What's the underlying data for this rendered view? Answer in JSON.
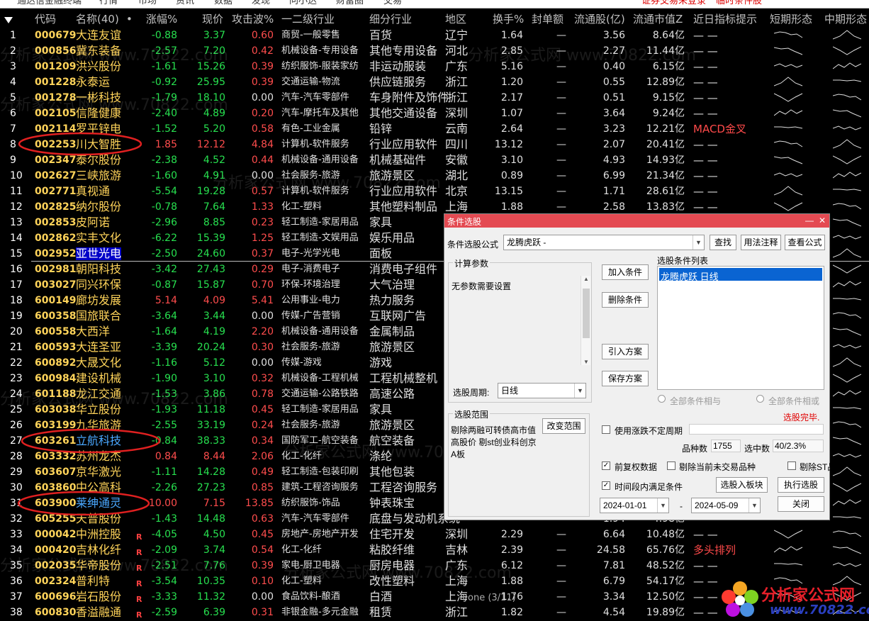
{
  "menu": {
    "items": [
      "通达信金融终端",
      "行情",
      "市场",
      "资讯",
      "数据",
      "发现",
      "问小达",
      "财富圈",
      "交易"
    ],
    "status_login": "证券交易未登录",
    "status_condition": "临时条件股"
  },
  "grid": {
    "headers": [
      "代码",
      "名称(40)",
      "•",
      "涨幅%",
      "现价",
      "攻击波%",
      "一二级行业",
      "细分行业",
      "地区",
      "换手%",
      "封单额",
      "流通股(亿)",
      "流通市值Z",
      "近日指标提示",
      "短期形态",
      "中期形态"
    ],
    "rows": [
      {
        "idx": "1",
        "code": "000679",
        "name": "大连友谊",
        "flag": "",
        "chg": "-0.88",
        "price": "3.37",
        "atk": "0.60",
        "ind1": "商贸-一般零售",
        "ind2": "百货",
        "region": "辽宁",
        "turn": "1.64",
        "seal": "—",
        "cap": "3.56",
        "mcap": "8.64亿",
        "hint": "— —"
      },
      {
        "idx": "2",
        "code": "000856",
        "name": "冀东装备",
        "flag": "",
        "chg": "-2.57",
        "price": "7.20",
        "atk": "0.42",
        "ind1": "机械设备-专用设备",
        "ind2": "其他专用设备",
        "region": "河北",
        "turn": "2.85",
        "seal": "—",
        "cap": "2.27",
        "mcap": "11.44亿",
        "hint": "— —"
      },
      {
        "idx": "3",
        "code": "001209",
        "name": "洪兴股份",
        "flag": "",
        "chg": "-1.61",
        "price": "15.26",
        "atk": "0.39",
        "ind1": "纺织服饰-服装家纺",
        "ind2": "非运动服装",
        "region": "广东",
        "turn": "5.16",
        "seal": "—",
        "cap": "0.40",
        "mcap": "6.15亿",
        "hint": "— —"
      },
      {
        "idx": "4",
        "code": "001228",
        "name": "永泰运",
        "flag": "",
        "chg": "-0.92",
        "price": "25.95",
        "atk": "0.39",
        "ind1": "交通运输-物流",
        "ind2": "供应链服务",
        "region": "浙江",
        "turn": "1.20",
        "seal": "—",
        "cap": "0.55",
        "mcap": "12.89亿",
        "hint": "— —"
      },
      {
        "idx": "5",
        "code": "001278",
        "name": "一彬科技",
        "flag": "",
        "chg": "-1.79",
        "price": "18.10",
        "atk": "0.00",
        "ind1": "汽车-汽车零部件",
        "ind2": "车身附件及饰件",
        "region": "浙江",
        "turn": "2.17",
        "seal": "—",
        "cap": "0.51",
        "mcap": "9.15亿",
        "hint": "— —"
      },
      {
        "idx": "6",
        "code": "002105",
        "name": "信隆健康",
        "flag": "",
        "chg": "-2.40",
        "price": "4.89",
        "atk": "0.20",
        "ind1": "汽车-摩托车及其他",
        "ind2": "其他交通设备",
        "region": "深圳",
        "turn": "1.07",
        "seal": "—",
        "cap": "3.64",
        "mcap": "9.24亿",
        "hint": "— —"
      },
      {
        "idx": "7",
        "code": "002114",
        "name": "罗平锌电",
        "flag": "",
        "chg": "-1.52",
        "price": "5.20",
        "atk": "0.58",
        "ind1": "有色-工业金属",
        "ind2": "铅锌",
        "region": "云南",
        "turn": "2.64",
        "seal": "—",
        "cap": "3.23",
        "mcap": "12.21亿",
        "hint": "MACD金叉"
      },
      {
        "idx": "8",
        "code": "002253",
        "name": "川大智胜",
        "flag": "",
        "chg": "1.85",
        "price": "12.12",
        "atk": "4.84",
        "ind1": "计算机-软件服务",
        "ind2": "行业应用软件",
        "region": "四川",
        "turn": "13.12",
        "seal": "—",
        "cap": "2.07",
        "mcap": "20.41亿",
        "hint": "— —"
      },
      {
        "idx": "9",
        "code": "002347",
        "name": "泰尔股份",
        "flag": "",
        "chg": "-2.38",
        "price": "4.52",
        "atk": "0.44",
        "ind1": "机械设备-通用设备",
        "ind2": "机械基础件",
        "region": "安徽",
        "turn": "3.10",
        "seal": "—",
        "cap": "4.93",
        "mcap": "14.93亿",
        "hint": "— —"
      },
      {
        "idx": "10",
        "code": "002627",
        "name": "三峡旅游",
        "flag": "",
        "chg": "-1.60",
        "price": "4.91",
        "atk": "0.00",
        "ind1": "社会服务-旅游",
        "ind2": "旅游景区",
        "region": "湖北",
        "turn": "0.89",
        "seal": "—",
        "cap": "6.99",
        "mcap": "21.34亿",
        "hint": "— —"
      },
      {
        "idx": "11",
        "code": "002771",
        "name": "真视通",
        "flag": "",
        "chg": "-5.54",
        "price": "19.28",
        "atk": "0.57",
        "ind1": "计算机-软件服务",
        "ind2": "行业应用软件",
        "region": "北京",
        "turn": "13.15",
        "seal": "—",
        "cap": "1.71",
        "mcap": "28.61亿",
        "hint": "— —"
      },
      {
        "idx": "12",
        "code": "002825",
        "name": "纳尔股份",
        "flag": "",
        "chg": "-0.78",
        "price": "7.64",
        "atk": "1.33",
        "ind1": "化工-塑料",
        "ind2": "其他塑料制品",
        "region": "上海",
        "turn": "1.88",
        "seal": "—",
        "cap": "2.58",
        "mcap": "13.83亿",
        "hint": "— —"
      },
      {
        "idx": "13",
        "code": "002853",
        "name": "皮阿诺",
        "flag": "",
        "chg": "-2.96",
        "price": "8.85",
        "atk": "0.23",
        "ind1": "轻工制造-家居用品",
        "ind2": "家具",
        "region": "",
        "turn": "",
        "seal": "",
        "cap": "",
        "mcap": "",
        "hint": ""
      },
      {
        "idx": "14",
        "code": "002862",
        "name": "实丰文化",
        "flag": "",
        "chg": "-6.22",
        "price": "15.39",
        "atk": "1.25",
        "ind1": "轻工制造-文娱用品",
        "ind2": "娱乐用品",
        "region": "",
        "turn": "",
        "seal": "",
        "cap": "",
        "mcap": "",
        "hint": ""
      },
      {
        "idx": "15",
        "code": "002952",
        "name": "亚世光电",
        "flag": "",
        "chg": "-2.50",
        "price": "24.60",
        "atk": "0.37",
        "ind1": "电子-光学光电",
        "ind2": "面板",
        "region": "",
        "turn": "",
        "seal": "",
        "cap": "",
        "mcap": "",
        "hint": ""
      },
      {
        "idx": "16",
        "code": "002981",
        "name": "朝阳科技",
        "flag": "",
        "chg": "-3.42",
        "price": "27.43",
        "atk": "0.29",
        "ind1": "电子-消费电子",
        "ind2": "消费电子组件",
        "region": "",
        "turn": "",
        "seal": "",
        "cap": "",
        "mcap": "",
        "hint": ""
      },
      {
        "idx": "17",
        "code": "003027",
        "name": "同兴环保",
        "flag": "",
        "chg": "-0.87",
        "price": "15.87",
        "atk": "0.70",
        "ind1": "环保-环境治理",
        "ind2": "大气治理",
        "region": "",
        "turn": "",
        "seal": "",
        "cap": "",
        "mcap": "",
        "hint": ""
      },
      {
        "idx": "18",
        "code": "600149",
        "name": "廊坊发展",
        "flag": "",
        "chg": "5.14",
        "price": "4.09",
        "atk": "5.41",
        "ind1": "公用事业-电力",
        "ind2": "热力服务",
        "region": "",
        "turn": "",
        "seal": "",
        "cap": "",
        "mcap": "",
        "hint": ""
      },
      {
        "idx": "19",
        "code": "600358",
        "name": "国旅联合",
        "flag": "",
        "chg": "-3.64",
        "price": "3.44",
        "atk": "0.00",
        "ind1": "传媒-广告营销",
        "ind2": "互联网广告",
        "region": "",
        "turn": "",
        "seal": "",
        "cap": "",
        "mcap": "",
        "hint": ""
      },
      {
        "idx": "20",
        "code": "600558",
        "name": "大西洋",
        "flag": "",
        "chg": "-1.64",
        "price": "4.19",
        "atk": "2.20",
        "ind1": "机械设备-通用设备",
        "ind2": "金属制品",
        "region": "",
        "turn": "",
        "seal": "",
        "cap": "",
        "mcap": "",
        "hint": ""
      },
      {
        "idx": "21",
        "code": "600593",
        "name": "大连圣亚",
        "flag": "",
        "chg": "-3.39",
        "price": "20.24",
        "atk": "0.30",
        "ind1": "社会服务-旅游",
        "ind2": "旅游景区",
        "region": "",
        "turn": "",
        "seal": "",
        "cap": "",
        "mcap": "",
        "hint": ""
      },
      {
        "idx": "22",
        "code": "600892",
        "name": "大晟文化",
        "flag": "",
        "chg": "-1.16",
        "price": "5.12",
        "atk": "0.00",
        "ind1": "传媒-游戏",
        "ind2": "游戏",
        "region": "",
        "turn": "",
        "seal": "",
        "cap": "",
        "mcap": "",
        "hint": ""
      },
      {
        "idx": "23",
        "code": "600984",
        "name": "建设机械",
        "flag": "",
        "chg": "-1.90",
        "price": "3.10",
        "atk": "0.32",
        "ind1": "机械设备-工程机械",
        "ind2": "工程机械整机",
        "region": "",
        "turn": "",
        "seal": "",
        "cap": "",
        "mcap": "",
        "hint": ""
      },
      {
        "idx": "24",
        "code": "601188",
        "name": "龙江交通",
        "flag": "",
        "chg": "-1.53",
        "price": "3.86",
        "atk": "0.78",
        "ind1": "交通运输-公路铁路",
        "ind2": "高速公路",
        "region": "",
        "turn": "",
        "seal": "",
        "cap": "",
        "mcap": "",
        "hint": ""
      },
      {
        "idx": "25",
        "code": "603038",
        "name": "华立股份",
        "flag": "",
        "chg": "-1.93",
        "price": "11.18",
        "atk": "0.45",
        "ind1": "轻工制造-家居用品",
        "ind2": "家具",
        "region": "",
        "turn": "",
        "seal": "",
        "cap": "",
        "mcap": "",
        "hint": ""
      },
      {
        "idx": "26",
        "code": "603199",
        "name": "九华旅游",
        "flag": "",
        "chg": "-2.55",
        "price": "33.19",
        "atk": "0.24",
        "ind1": "社会服务-旅游",
        "ind2": "旅游景区",
        "region": "",
        "turn": "",
        "seal": "",
        "cap": "",
        "mcap": "",
        "hint": ""
      },
      {
        "idx": "27",
        "code": "603261",
        "name": "立航科技",
        "flag": "",
        "chg": "-0.84",
        "price": "38.33",
        "atk": "0.34",
        "ind1": "国防军工-航空装备",
        "ind2": "航空装备",
        "region": "",
        "turn": "",
        "seal": "",
        "cap": "",
        "mcap": "",
        "hint": ""
      },
      {
        "idx": "28",
        "code": "603332",
        "name": "苏州龙杰",
        "flag": "",
        "chg": "0.84",
        "price": "8.44",
        "atk": "2.06",
        "ind1": "化工-化纤",
        "ind2": "涤纶",
        "region": "",
        "turn": "",
        "seal": "",
        "cap": "",
        "mcap": "",
        "hint": ""
      },
      {
        "idx": "29",
        "code": "603607",
        "name": "京华激光",
        "flag": "",
        "chg": "-1.11",
        "price": "14.28",
        "atk": "0.49",
        "ind1": "轻工制造-包装印刷",
        "ind2": "其他包装",
        "region": "",
        "turn": "",
        "seal": "",
        "cap": "",
        "mcap": "",
        "hint": ""
      },
      {
        "idx": "30",
        "code": "603860",
        "name": "中公高科",
        "flag": "",
        "chg": "-2.26",
        "price": "27.23",
        "atk": "0.85",
        "ind1": "建筑-工程咨询服务",
        "ind2": "工程咨询服务",
        "region": "",
        "turn": "",
        "seal": "",
        "cap": "",
        "mcap": "",
        "hint": ""
      },
      {
        "idx": "31",
        "code": "603900",
        "name": "莱绅通灵",
        "flag": "",
        "chg": "10.00",
        "price": "7.15",
        "atk": "13.85",
        "ind1": "纺织服饰-饰品",
        "ind2": "钟表珠宝",
        "region": "",
        "turn": "",
        "seal": "",
        "cap": "",
        "mcap": "",
        "hint": ""
      },
      {
        "idx": "32",
        "code": "605255",
        "name": "天普股份",
        "flag": "",
        "chg": "-1.43",
        "price": "14.48",
        "atk": "0.63",
        "ind1": "汽车-汽车零部件",
        "ind2": "底盘与发动机系统",
        "region": "",
        "turn": "",
        "seal": "",
        "cap": "1.94",
        "mcap": "4.98亿",
        "hint": "— —"
      },
      {
        "idx": "33",
        "code": "000042",
        "name": "中洲控股",
        "flag": "R",
        "chg": "-4.05",
        "price": "4.50",
        "atk": "0.45",
        "ind1": "房地产-房地产开发",
        "ind2": "住宅开发",
        "region": "深圳",
        "turn": "2.29",
        "seal": "—",
        "cap": "6.64",
        "mcap": "10.48亿",
        "hint": "— —"
      },
      {
        "idx": "34",
        "code": "000420",
        "name": "吉林化纤",
        "flag": "R",
        "chg": "-2.09",
        "price": "3.74",
        "atk": "0.54",
        "ind1": "化工-化纤",
        "ind2": "粘胶纤维",
        "region": "吉林",
        "turn": "2.39",
        "seal": "—",
        "cap": "24.58",
        "mcap": "65.76亿",
        "hint": "多头排列"
      },
      {
        "idx": "35",
        "code": "002035",
        "name": "华帝股份",
        "flag": "R",
        "chg": "-2.51",
        "price": "7.76",
        "atk": "0.39",
        "ind1": "家电-厨卫电器",
        "ind2": "厨房电器",
        "region": "广东",
        "turn": "6.12",
        "seal": "—",
        "cap": "7.81",
        "mcap": "48.52亿",
        "hint": "— —"
      },
      {
        "idx": "36",
        "code": "002324",
        "name": "普利特",
        "flag": "R",
        "chg": "-3.54",
        "price": "10.35",
        "atk": "0.10",
        "ind1": "化工-塑料",
        "ind2": "改性塑料",
        "region": "上海",
        "turn": "1.88",
        "seal": "—",
        "cap": "6.79",
        "mcap": "54.17亿",
        "hint": "— —"
      },
      {
        "idx": "37",
        "code": "600696",
        "name": "岩石股份",
        "flag": "R",
        "chg": "-3.33",
        "price": "11.32",
        "atk": "0.00",
        "ind1": "食品饮料-酿酒",
        "ind2": "白酒",
        "region": "上海",
        "turn": "1.76",
        "seal": "—",
        "cap": "3.34",
        "mcap": "12.50亿",
        "hint": "— —"
      },
      {
        "idx": "38",
        "code": "600830",
        "name": "香溢融通",
        "flag": "R",
        "chg": "-2.59",
        "price": "6.39",
        "atk": "0.31",
        "ind1": "非银金融-多元金融",
        "ind2": "租赁",
        "region": "浙江",
        "turn": "1.82",
        "seal": "—",
        "cap": "4.54",
        "mcap": "19.89亿",
        "hint": "— —"
      }
    ]
  },
  "dialog": {
    "title": "条件选股",
    "formula_label": "条件选股公式",
    "formula_value": "龙腾虎跃  -",
    "btn_find": "查找",
    "btn_usage": "用法注释",
    "btn_view": "查看公式",
    "calc_params_label": "计算参数",
    "no_params_text": "无参数需要设置",
    "btn_add": "加入条件",
    "btn_delete": "删除条件",
    "btn_import": "引入方案",
    "btn_save": "保存方案",
    "list_label": "选股条件列表",
    "list_item": "龙腾虎跃  日线",
    "period_label": "选股周期:",
    "period_value": "日线",
    "radio_and": "全部条件相与",
    "radio_or": "全部条件相或",
    "status": "选股完毕.",
    "range_label": "选股范围",
    "range_text_1": "剔除两融可转债高市值",
    "range_text_2": "高股价 剔st创业科创京",
    "range_text_3": "A板",
    "btn_change_range": "改变范围",
    "chk_uncertain": "使用涨跌不定周期",
    "count_label": "品种数",
    "count_value": "1755",
    "selected_label": "选中数",
    "selected_value": "40/2.3%",
    "chk_adjust": "前复权数据",
    "chk_exclude_untraded": "剔除当前未交易品种",
    "chk_exclude_st": "剔除ST品种",
    "chk_period": "时间段内满足条件",
    "btn_to_block": "选股入板块",
    "btn_execute": "执行选股",
    "date_start": "2024-01-01",
    "date_dash": "-",
    "date_end": "2024-05-09",
    "btn_close": "关闭"
  },
  "watermark": {
    "site_text": "分析家公式网 www.70822.com",
    "logo_title": "分析家公式网",
    "logo_url": "www.70822.com"
  },
  "footer": {
    "page_indicator": "one (3/11)"
  },
  "colors": {
    "up": "#ff4d4d",
    "down": "#27e04f",
    "code": "#ffd45a",
    "selected_name": "#0000c8",
    "dialog_title": "#e44a52",
    "list_selected": "#0a64d2",
    "highlight_circle": "#e02020"
  }
}
